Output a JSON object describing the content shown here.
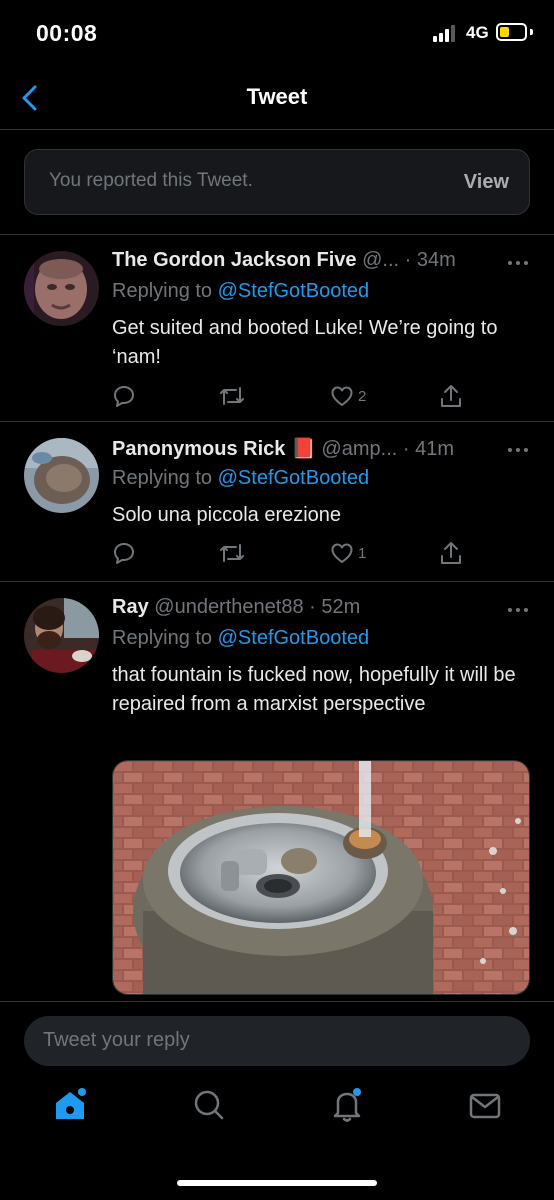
{
  "status_bar": {
    "time": "00:08",
    "network": "4G"
  },
  "header": {
    "title": "Tweet"
  },
  "report_notice": {
    "text": "You reported this Tweet.",
    "action": "View"
  },
  "tweets": [
    {
      "name": "The Gordon Jackson Five",
      "handle": "@...",
      "time": "· 34m",
      "replying_label": "Replying to",
      "replying_to": "@StefGotBooted",
      "text": "Get suited and booted Luke! We’re going to ‘nam!",
      "likes": "2"
    },
    {
      "name": "Panonymous Rick",
      "name_emoji": "📕",
      "handle": "@amp...",
      "time": "· 41m",
      "replying_label": "Replying to",
      "replying_to": "@StefGotBooted",
      "text": "Solo una piccola erezione",
      "likes": "1"
    },
    {
      "name": "Ray",
      "handle": "@underthenet88",
      "time": "· 52m",
      "replying_label": "Replying to",
      "replying_to": "@StefGotBooted",
      "text": "that fountain is fucked now, hopefully it will be repaired from a marxist perspective"
    }
  ],
  "reply_bar": {
    "placeholder": "Tweet your reply"
  },
  "colors": {
    "accent": "#1d9bf0",
    "background": "#000000",
    "muted": "#71767b"
  },
  "icons": [
    "back-chevron-icon",
    "reply-icon",
    "retweet-icon",
    "like-icon",
    "share-icon",
    "more-icon",
    "home-icon",
    "search-icon",
    "notifications-icon",
    "messages-icon"
  ]
}
